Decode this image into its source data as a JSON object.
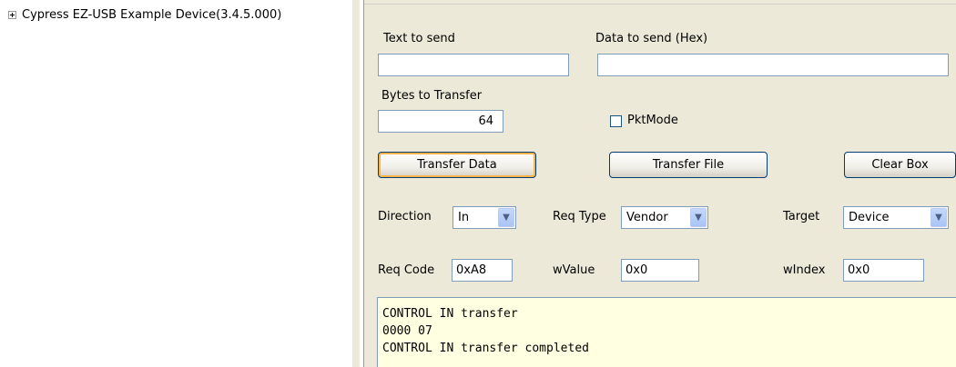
{
  "tree": {
    "device_label": "Cypress EZ-USB Example Device(3.4.5.000)"
  },
  "form": {
    "text_to_send_label": "Text to send",
    "text_to_send_value": "",
    "data_to_send_label": "Data to send (Hex)",
    "data_to_send_value": "",
    "bytes_label": "Bytes to Transfer",
    "bytes_value": "64",
    "pktmode_label": "PktMode",
    "pktmode_checked": false,
    "transfer_data_button": "Transfer Data",
    "transfer_file_button": "Transfer File",
    "clear_box_button": "Clear Box",
    "direction_label": "Direction",
    "direction_value": "In",
    "req_type_label": "Req Type",
    "req_type_value": "Vendor",
    "target_label": "Target",
    "target_value": "Device",
    "req_code_label": "Req Code",
    "req_code_value": "0xA8",
    "wvalue_label": "wValue",
    "wvalue_value": "0x0",
    "windex_label": "wIndex",
    "windex_value": "0x0"
  },
  "log": {
    "lines": [
      "CONTROL IN transfer",
      "0000 07",
      "CONTROL IN transfer completed"
    ]
  },
  "colors": {
    "panel_bg": "#ece9d8",
    "log_bg": "#ffffe1",
    "input_border": "#7f9db9",
    "default_button_glow": "#f9b34a"
  }
}
